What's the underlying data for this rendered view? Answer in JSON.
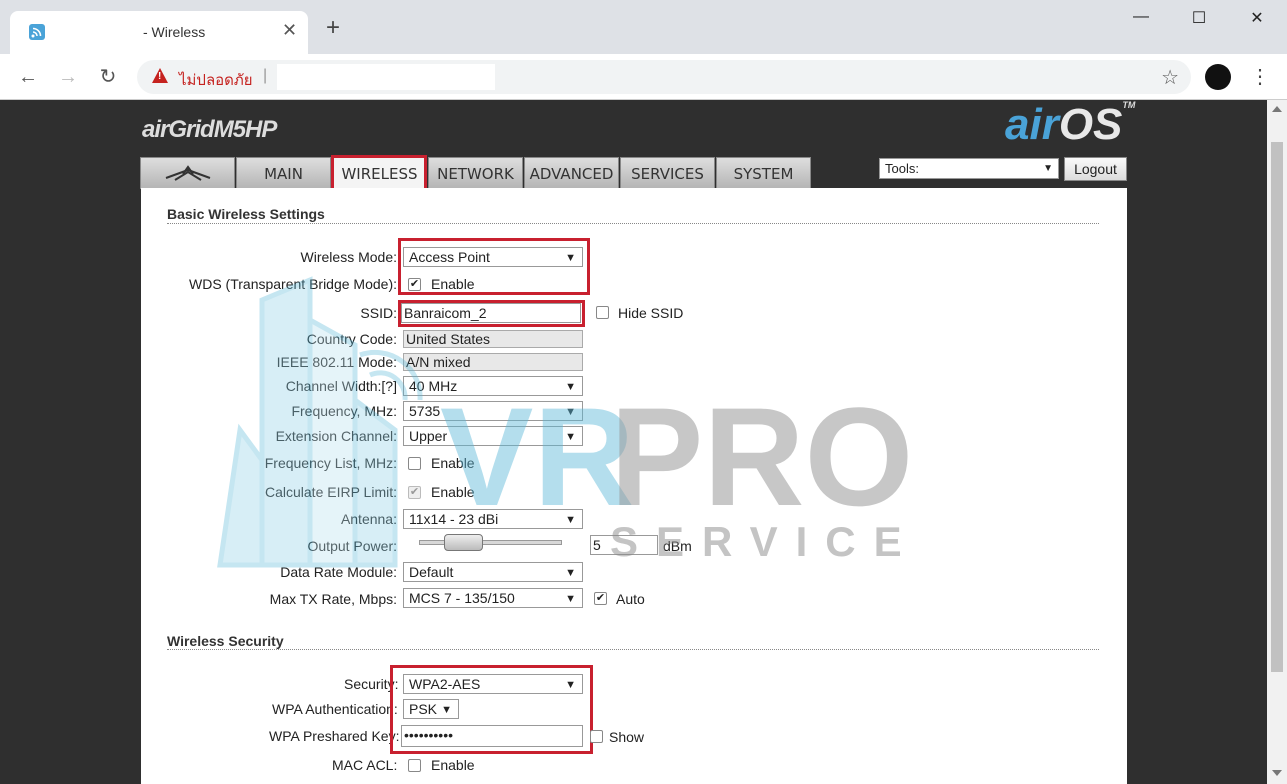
{
  "browser": {
    "tab_title": "- Wireless",
    "close_glyph": "✕",
    "new_tab_glyph": "+",
    "insecure_label": "ไม่ปลอดภัย",
    "separator": "|",
    "back_glyph": "←",
    "forward_glyph": "→",
    "reload_glyph": "↻",
    "star_glyph": "☆",
    "menu_glyph": "⋮",
    "minimize_glyph": "—",
    "maximize_glyph": "☐",
    "window_close_glyph": "✕"
  },
  "header": {
    "product_prefix": "air",
    "product_name": "Grid",
    "product_model": "M5HP",
    "os_prefix": "air",
    "os_name": "OS",
    "os_tm": "TM"
  },
  "tabs": [
    {
      "label": "MAIN"
    },
    {
      "label": "WIRELESS"
    },
    {
      "label": "NETWORK"
    },
    {
      "label": "ADVANCED"
    },
    {
      "label": "SERVICES"
    },
    {
      "label": "SYSTEM"
    }
  ],
  "tools": {
    "label": "Tools:",
    "arrow": "▼"
  },
  "logout_label": "Logout",
  "basic": {
    "title": "Basic Wireless Settings",
    "wireless_mode_label": "Wireless Mode:",
    "wireless_mode_value": "Access Point",
    "wds_label": "WDS (Transparent Bridge Mode):",
    "wds_enable": "Enable",
    "ssid_label": "SSID:",
    "ssid_value": "Banraicom_2",
    "hide_ssid": "Hide SSID",
    "country_label": "Country Code:",
    "country_value": "United States",
    "ieee_label": "IEEE 802.11 Mode:",
    "ieee_value": "A/N mixed",
    "channel_width_label": "Channel Width:[?]",
    "channel_width_value": "40 MHz",
    "frequency_label": "Frequency, MHz:",
    "frequency_value": "5735",
    "ext_channel_label": "Extension Channel:",
    "ext_channel_value": "Upper",
    "freq_list_label": "Frequency List, MHz:",
    "freq_list_enable": "Enable",
    "eirp_label": "Calculate EIRP Limit:",
    "eirp_enable": "Enable",
    "antenna_label": "Antenna:",
    "antenna_value": "11x14 - 23 dBi",
    "output_power_label": "Output Power:",
    "output_power_value": "5",
    "output_power_unit": "dBm",
    "data_rate_label": "Data Rate Module:",
    "data_rate_value": "Default",
    "max_tx_label": "Max TX Rate, Mbps:",
    "max_tx_value": "MCS 7 - 135/150",
    "max_tx_auto": "Auto"
  },
  "security": {
    "title": "Wireless Security",
    "security_label": "Security:",
    "security_value": "WPA2-AES",
    "wpa_auth_label": "WPA Authentication:",
    "wpa_auth_value": "PSK",
    "wpa_key_label": "WPA Preshared Key:",
    "wpa_key_value": "••••••••••",
    "show_label": "Show",
    "mac_acl_label": "MAC ACL:",
    "mac_acl_enable": "Enable"
  },
  "watermark": {
    "big": "VRPRO",
    "small": "SERVICE"
  },
  "colors": {
    "highlight": "#c8202f",
    "air_blue": "#4aa3d8"
  },
  "icons": {
    "dropdown": "▼",
    "check": "✔"
  }
}
